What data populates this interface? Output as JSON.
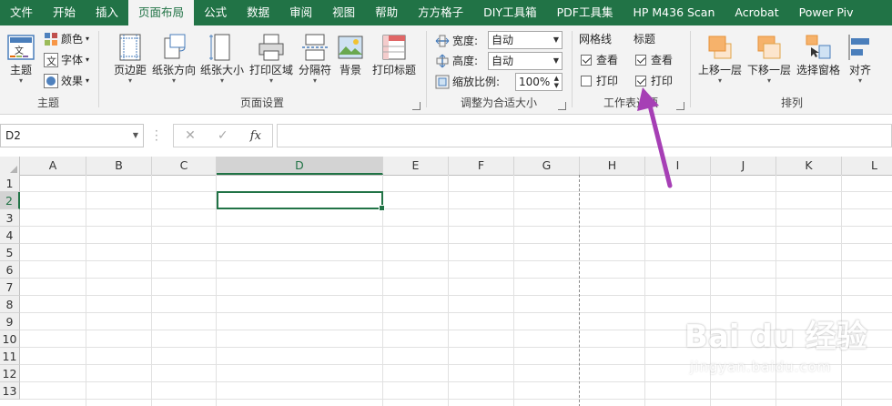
{
  "tabs": [
    "文件",
    "开始",
    "插入",
    "页面布局",
    "公式",
    "数据",
    "审阅",
    "视图",
    "帮助",
    "方方格子",
    "DIY工具箱",
    "PDF工具集",
    "HP M436 Scan",
    "Acrobat",
    "Power Piv"
  ],
  "active_tab": "页面布局",
  "ribbon": {
    "theme": {
      "big_label": "主题",
      "colors_label": "颜色",
      "fonts_label": "字体",
      "effects_label": "效果",
      "group_label": "主题"
    },
    "page_setup": {
      "buttons": [
        "页边距",
        "纸张方向",
        "纸张大小",
        "打印区域",
        "分隔符",
        "背景",
        "打印标题"
      ],
      "group_label": "页面设置"
    },
    "scale": {
      "width_label": "宽度:",
      "width_value": "自动",
      "height_label": "高度:",
      "height_value": "自动",
      "scale_label": "缩放比例:",
      "scale_value": "100%",
      "group_label": "调整为合适大小"
    },
    "sheet_options": {
      "gridlines_label": "网格线",
      "headings_label": "标题",
      "view_label": "查看",
      "print_label": "打印",
      "gridlines_view": true,
      "gridlines_print": false,
      "headings_view": true,
      "headings_print": true,
      "group_label": "工作表选项"
    },
    "arrange": {
      "buttons": [
        "上移一层",
        "下移一层",
        "选择窗格",
        "对齐"
      ],
      "group_label": "排列"
    }
  },
  "formula_bar": {
    "name_box": "D2",
    "cancel_icon": "✕",
    "enter_icon": "✓",
    "fx_label": "fx",
    "formula": ""
  },
  "grid": {
    "columns": [
      "A",
      "B",
      "C",
      "D",
      "E",
      "F",
      "G",
      "H",
      "I",
      "J",
      "K",
      "L"
    ],
    "rows": [
      "1",
      "2",
      "3",
      "4",
      "5",
      "6",
      "7",
      "8",
      "9",
      "10",
      "11",
      "12",
      "13"
    ],
    "selected_cell": "D2"
  },
  "annotation": {
    "arrow_color": "#a63fb5"
  },
  "watermark": {
    "brand": "Bai du 经验",
    "url": "jingyan.baidu.com"
  },
  "colors": {
    "accent": "#217346",
    "tab_bar": "#217346"
  }
}
